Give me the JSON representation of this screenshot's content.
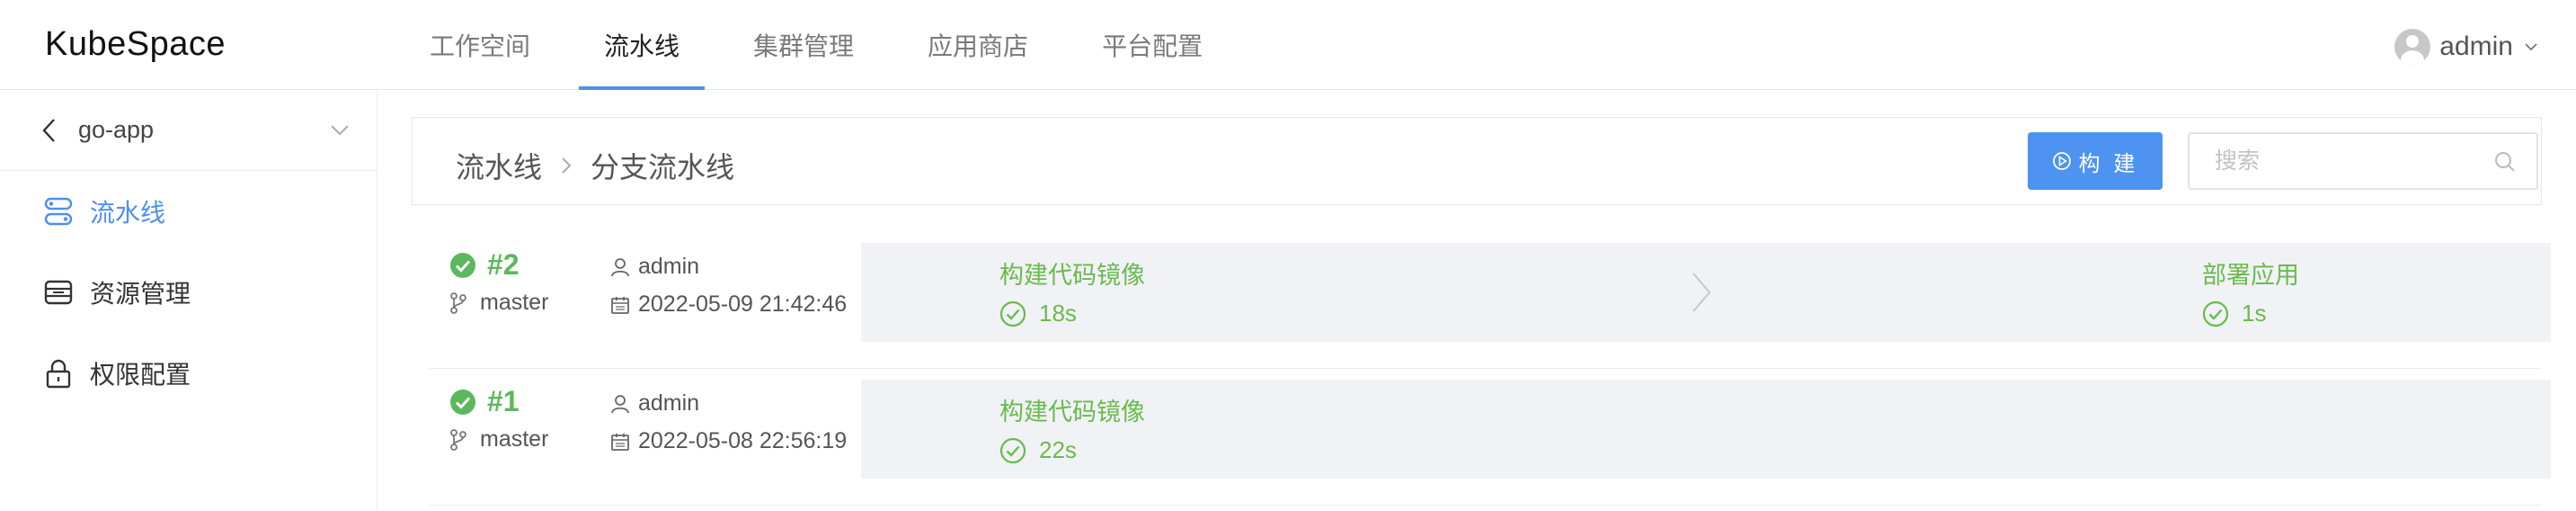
{
  "app": {
    "logo": "KubeSpace"
  },
  "nav": {
    "items": [
      {
        "label": "工作空间"
      },
      {
        "label": "流水线",
        "active": true
      },
      {
        "label": "集群管理"
      },
      {
        "label": "应用商店"
      },
      {
        "label": "平台配置"
      }
    ]
  },
  "user": {
    "name": "admin"
  },
  "sidebar": {
    "project": "go-app",
    "items": [
      {
        "label": "流水线",
        "icon": "pipeline-icon",
        "active": true
      },
      {
        "label": "资源管理",
        "icon": "storage-icon"
      },
      {
        "label": "权限配置",
        "icon": "lock-icon"
      }
    ]
  },
  "breadcrumb": {
    "parent": "流水线",
    "current": "分支流水线"
  },
  "toolbar": {
    "build_label": "构 建",
    "search_placeholder": "搜索"
  },
  "runs": [
    {
      "number": "#2",
      "branch": "master",
      "user": "admin",
      "date": "2022-05-09 21:42:46",
      "stages": [
        {
          "name": "构建代码镜像",
          "duration": "18s"
        },
        {
          "name": "部署应用",
          "duration": "1s"
        }
      ]
    },
    {
      "number": "#1",
      "branch": "master",
      "user": "admin",
      "date": "2022-05-08 22:56:19",
      "stages": [
        {
          "name": "构建代码镜像",
          "duration": "22s"
        }
      ]
    }
  ],
  "colors": {
    "accent": "#4e8ff0",
    "success": "#5cb85c",
    "stage_bg": "#f0f2f5"
  }
}
